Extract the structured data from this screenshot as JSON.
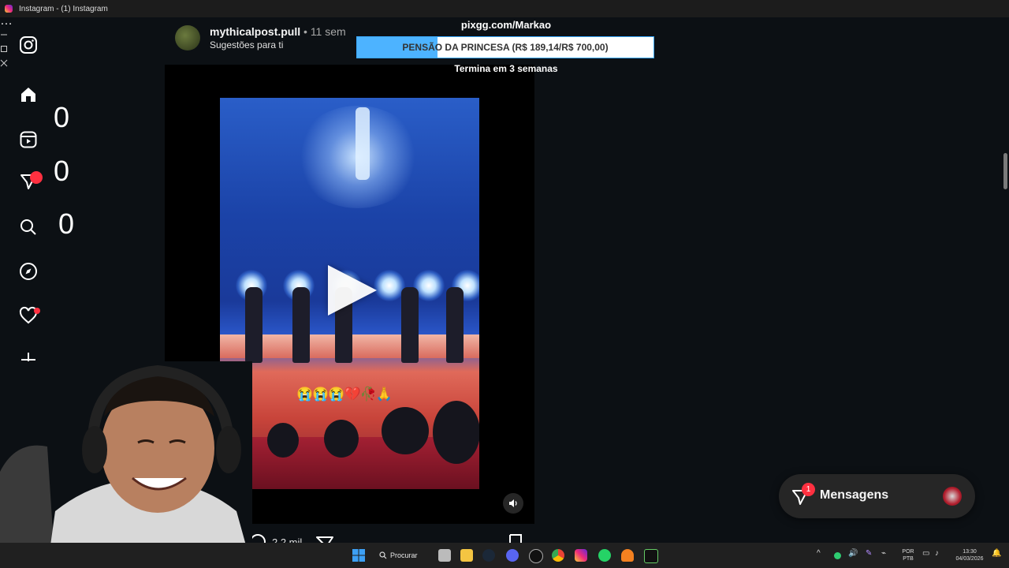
{
  "window": {
    "title": "Instagram - (1) Instagram",
    "controls": [
      "zoom-icon",
      "more-icon",
      "minimize-icon",
      "maximize-icon",
      "close-icon"
    ]
  },
  "sidebar": {
    "items": [
      {
        "name": "instagram-logo-icon"
      },
      {
        "name": "home-icon"
      },
      {
        "name": "reels-icon"
      },
      {
        "name": "messages-icon"
      },
      {
        "name": "search-icon"
      },
      {
        "name": "explore-icon"
      },
      {
        "name": "notifications-icon"
      },
      {
        "name": "create-icon"
      },
      {
        "name": "profile-avatar"
      },
      {
        "name": "more-menu-icon"
      }
    ]
  },
  "counters": [
    "0",
    "0",
    "0"
  ],
  "post": {
    "username": "mythicalpost.pull",
    "separator": "•",
    "time": "11 sem",
    "subtitle": "Sugestões para ti",
    "caption_emojis": "😭😭😭💔🥀🙏",
    "likes_count": "2,2 mil"
  },
  "stream_overlay": {
    "site": "pixgg.com/Markao",
    "goal_text": "PENSÃO DA PRINCESA (R$ 189,14/R$ 700,00)",
    "goal_current": 189.14,
    "goal_target": 700.0,
    "ends_text": "Termina em 3 semanas"
  },
  "messages": {
    "label": "Mensagens",
    "badge": "1"
  },
  "taskbar": {
    "search_label": "Procurar",
    "lang_1": "POR",
    "lang_2": "PTB",
    "time": "13:30",
    "date": "04/03/2026"
  },
  "colors": {
    "background": "#0c1014",
    "accent_blue": "#4db3ff",
    "notification_red": "#ff3040"
  }
}
